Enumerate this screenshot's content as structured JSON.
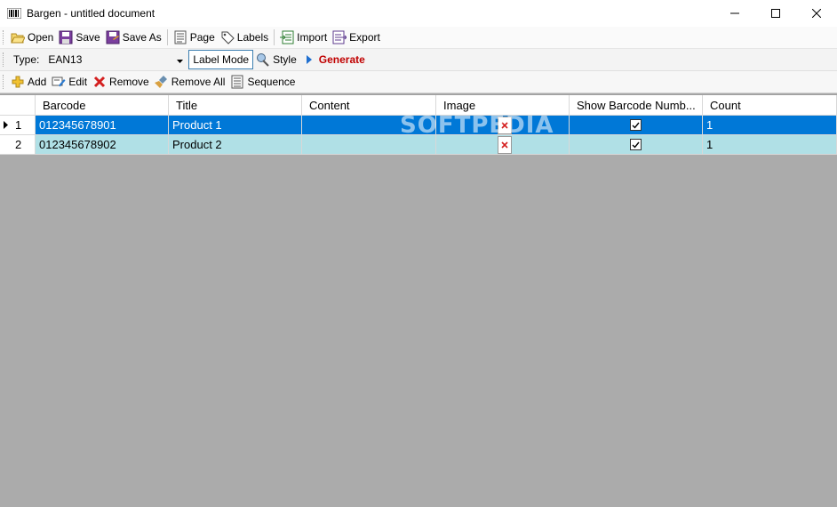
{
  "window": {
    "title": "Bargen - untitled document"
  },
  "toolbar_main": {
    "open": "Open",
    "save": "Save",
    "save_as": "Save As",
    "page": "Page",
    "labels": "Labels",
    "import": "Import",
    "export": "Export"
  },
  "toolbar_generate": {
    "type_label": "Type:",
    "type_value": "EAN13",
    "label_mode": "Label Mode",
    "style": "Style",
    "generate": "Generate"
  },
  "toolbar_rows": {
    "add": "Add",
    "edit": "Edit",
    "remove": "Remove",
    "remove_all": "Remove All",
    "sequence": "Sequence"
  },
  "grid": {
    "columns": [
      "",
      "Barcode",
      "Title",
      "Content",
      "Image",
      "Show Barcode Numb...",
      "Count"
    ],
    "rows": [
      {
        "num": "1",
        "barcode": "012345678901",
        "title": "Product 1",
        "content": "",
        "show_number": true,
        "count": "1"
      },
      {
        "num": "2",
        "barcode": "012345678902",
        "title": "Product 2",
        "content": "",
        "show_number": true,
        "count": "1"
      }
    ]
  },
  "watermark": "SOFTPEDIA",
  "colors": {
    "selection": "#0078d7",
    "alt_row": "#b0e0e6",
    "generate": "#c00000",
    "workspace": "#ababab"
  }
}
